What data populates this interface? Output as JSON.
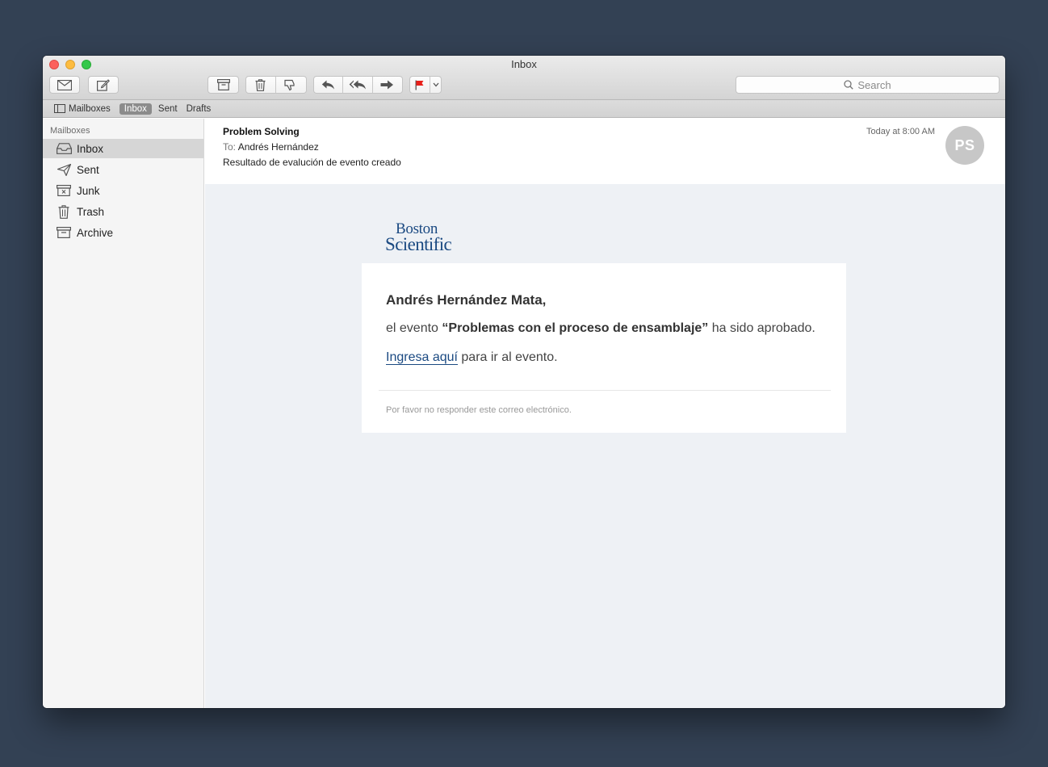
{
  "window": {
    "title": "Inbox"
  },
  "toolbar": {
    "get_mail": "get-mail-icon",
    "compose": "compose-icon",
    "archive": "archive-icon",
    "delete": "trash-icon",
    "junk": "thumbs-down-icon",
    "reply": "reply-icon",
    "reply_all": "reply-all-icon",
    "forward": "forward-icon",
    "flag": "flag-icon",
    "flag_color": "#e8201a",
    "search_placeholder": "Search"
  },
  "favorites": {
    "mailboxes": "Mailboxes",
    "inbox": "Inbox",
    "sent": "Sent",
    "drafts": "Drafts"
  },
  "sidebar": {
    "header": "Mailboxes",
    "items": [
      {
        "label": "Inbox",
        "icon": "inbox-icon",
        "selected": true
      },
      {
        "label": "Sent",
        "icon": "sent-icon"
      },
      {
        "label": "Junk",
        "icon": "junk-icon"
      },
      {
        "label": "Trash",
        "icon": "trash-icon"
      },
      {
        "label": "Archive",
        "icon": "archive-icon"
      }
    ]
  },
  "message": {
    "from": "Problem Solving",
    "to_label": "To:",
    "to": "Andrés Hernández",
    "subject": "Resultado de evalución de evento creado",
    "date": "Today at 8:00 AM",
    "avatar_initials": "PS"
  },
  "email": {
    "logo_line1": "Boston",
    "logo_line2": "Scientific",
    "brand_color": "#1b4a82",
    "greeting": "Andrés Hernández Mata,",
    "body_prefix": "el evento ",
    "event_name": "“Problemas con el proceso de ensamblaje”",
    "body_suffix": " ha sido aprobado.",
    "link_text": "Ingresa aquí",
    "link_suffix": " para ir al evento.",
    "footer": "Por favor no responder este correo electrónico."
  }
}
